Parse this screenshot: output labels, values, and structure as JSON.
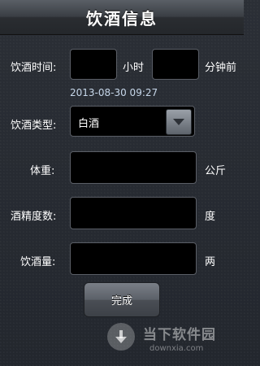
{
  "header": {
    "title": "饮酒信息"
  },
  "form": {
    "drink_time_label": "饮酒时间:",
    "hours_value": "",
    "hours_unit": "小时",
    "minutes_value": "",
    "minutes_unit": "分钟前",
    "timestamp": "2013-08-30 09:27",
    "drink_type_label": "饮酒类型:",
    "drink_type_value": "白酒",
    "weight_label": "体重:",
    "weight_value": "",
    "weight_unit": "公斤",
    "abv_label": "酒精度数:",
    "abv_value": "",
    "abv_unit": "度",
    "amount_label": "饮酒量:",
    "amount_value": "",
    "amount_unit": "两"
  },
  "done_button": {
    "label": "完成"
  },
  "watermark": {
    "name": "当下软件园",
    "url": "downxia.com"
  }
}
